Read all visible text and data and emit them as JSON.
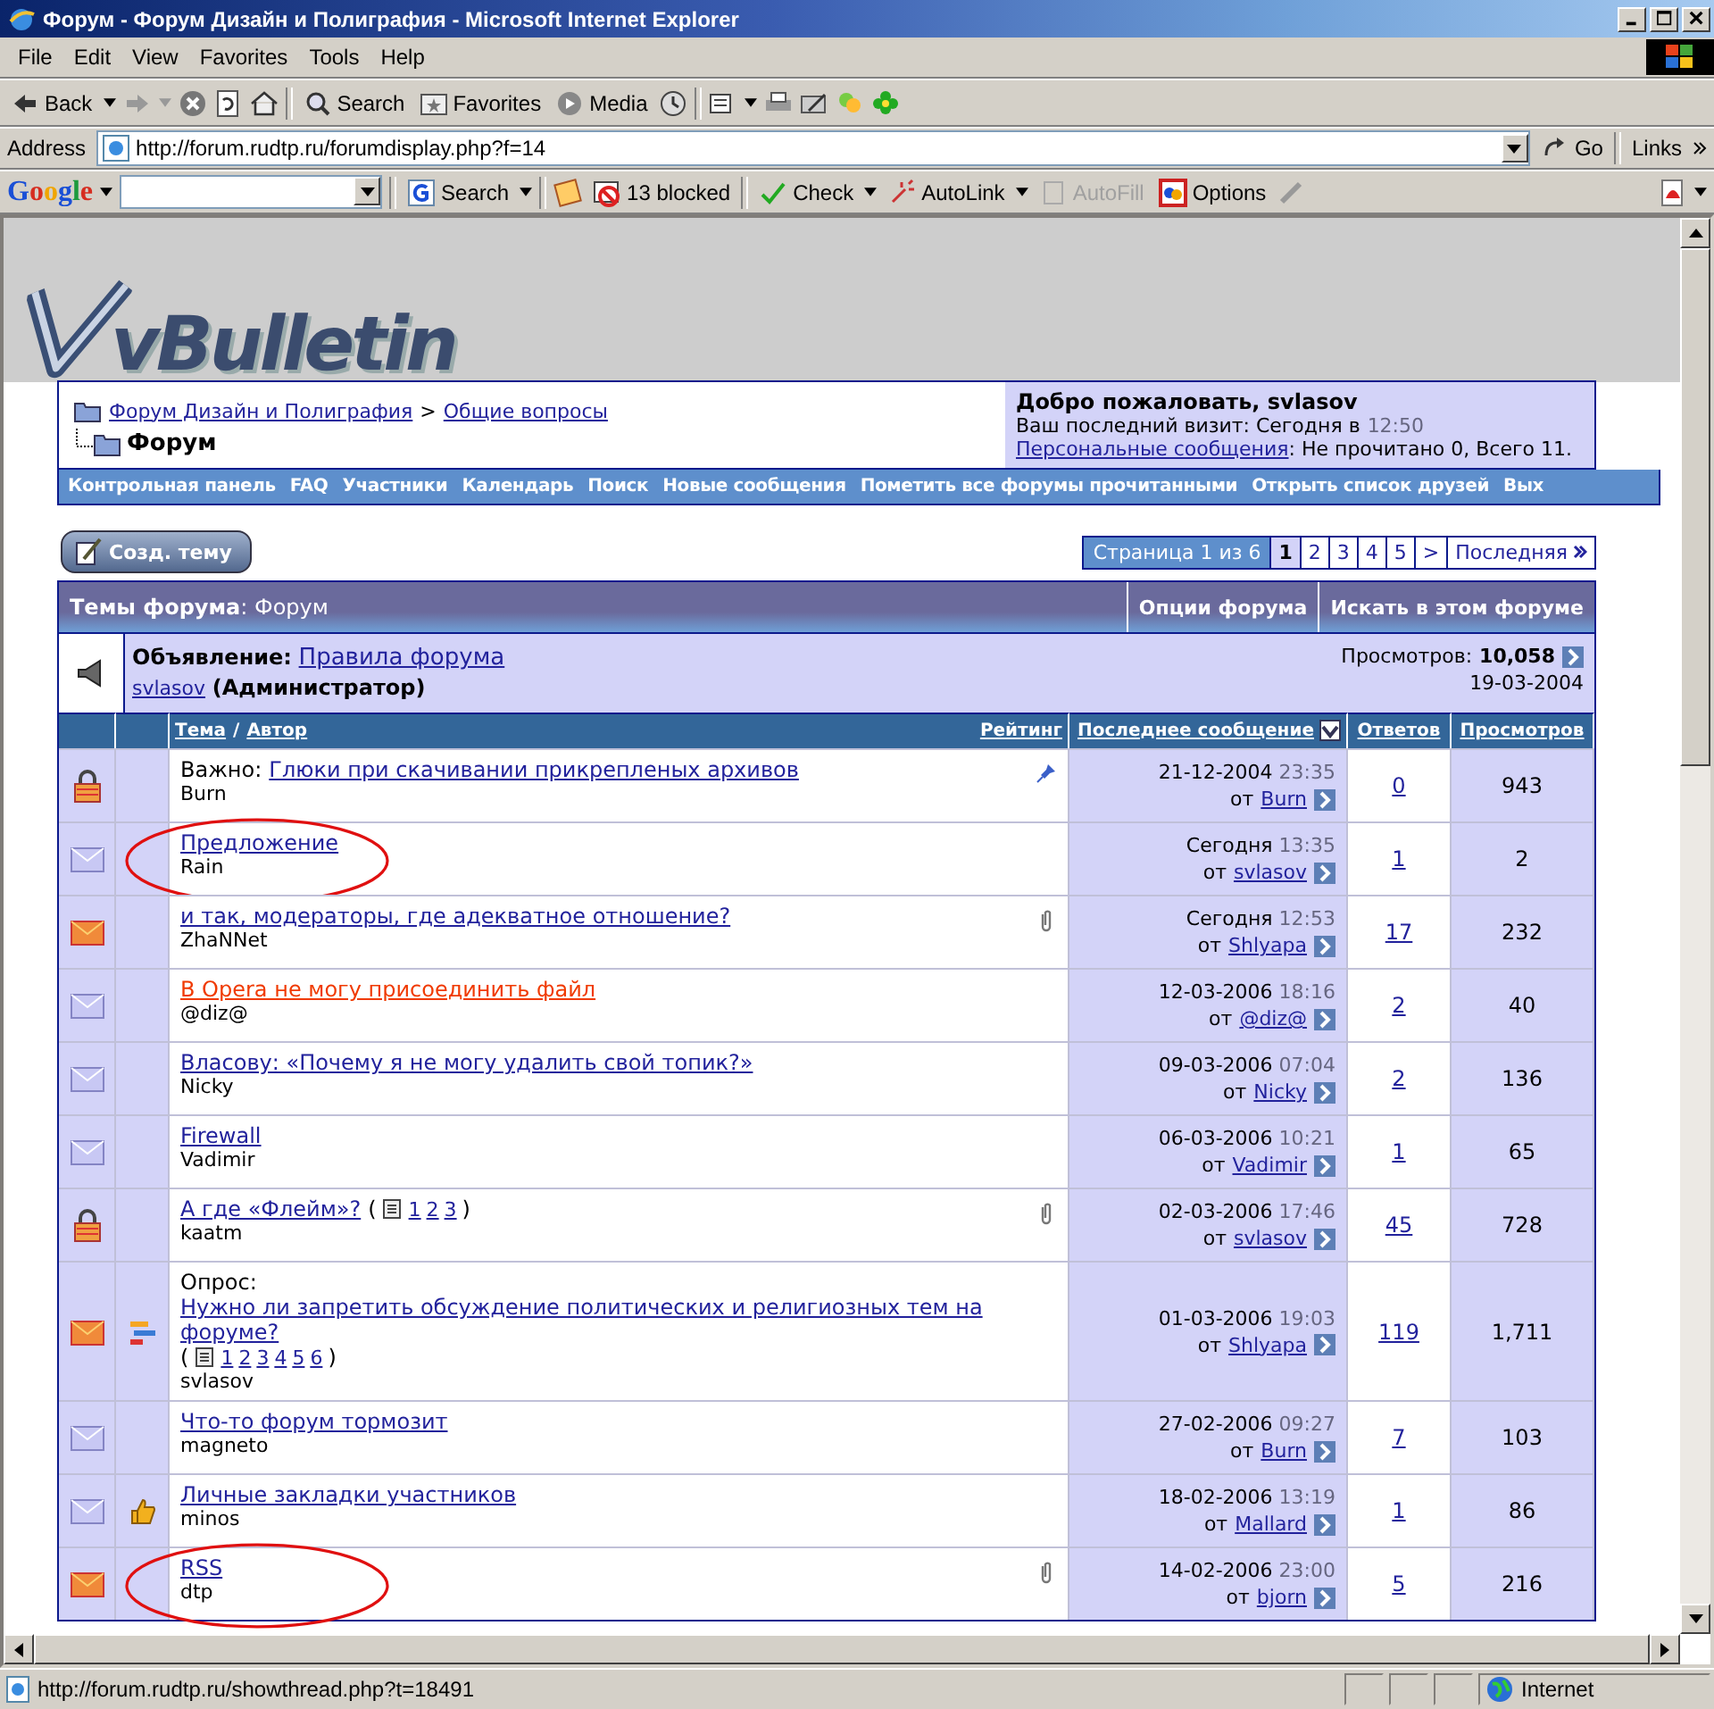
{
  "window": {
    "title": "Форум - Форум Дизайн и Полиграфия - Microsoft Internet Explorer"
  },
  "menu": [
    "File",
    "Edit",
    "View",
    "Favorites",
    "Tools",
    "Help"
  ],
  "toolbar": {
    "back": "Back",
    "search": "Search",
    "favorites": "Favorites",
    "media": "Media"
  },
  "address": {
    "label": "Address",
    "url": "http://forum.rudtp.ru/forumdisplay.php?f=14",
    "go": "Go",
    "links": "Links"
  },
  "google_bar": {
    "logo": "Google",
    "search": "Search",
    "blocked": "13 blocked",
    "check": "Check",
    "autolink": "AutoLink",
    "autofill": "AutoFill",
    "autofill_disabled": true,
    "options": "Options"
  },
  "logo": "vBulletin",
  "breadcrumb": {
    "links": [
      "Форум Дизайн и Полиграфия",
      "Общие вопросы"
    ],
    "separator": ">",
    "current": "Форум"
  },
  "welcome": {
    "title": "Добро пожаловать, svlasov",
    "last_visit": "Ваш последний визит: Сегодня в",
    "last_visit_time": "12:50",
    "pm_link": "Персональные сообщения",
    "pm_text": ": Не прочитано 0, Всего 11."
  },
  "navbar": [
    "Контрольная панель",
    "FAQ",
    "Участники",
    "Календарь",
    "Поиск",
    "Новые сообщения",
    "Пометить все форумы прочитанными",
    "Открыть список друзей",
    "Вых"
  ],
  "new_thread_button": "Созд. тему",
  "pagination": {
    "label": "Страница 1 из 6",
    "pages": [
      {
        "label": "1",
        "selected": true
      },
      {
        "label": "2",
        "selected": false
      },
      {
        "label": "3",
        "selected": false
      },
      {
        "label": "4",
        "selected": false
      },
      {
        "label": "5",
        "selected": false
      }
    ],
    "next": ">",
    "last": "Последняя"
  },
  "threads_header": {
    "title": "Темы форума",
    "forum": ": Форум",
    "buttons": [
      "Опции форума",
      "Искать в этом форуме"
    ]
  },
  "announcement": {
    "prefix": "Объявление:",
    "title": "Правила форума",
    "author": "svlasov",
    "role": "(Администратор)",
    "views_label": "Просмотров:",
    "views": "10,058",
    "date": "19-03-2004"
  },
  "columns": {
    "topic": "Тема",
    "slash": "/",
    "author": "Автор",
    "rating": "Рейтинг",
    "last_post": "Последнее сообщение",
    "replies": "Ответов",
    "views": "Просмотров"
  },
  "rows": [
    {
      "kind": "locked",
      "prefix": "Важно:",
      "title": "Глюки при скачивании прикрепленых архивов",
      "highlighted": false,
      "attachment": false,
      "sticky": true,
      "author": "Burn",
      "date": "21-12-2004",
      "time": "23:35",
      "by_label": "от",
      "last_by": "Burn",
      "replies": "0",
      "views": "943",
      "circled": false
    },
    {
      "kind": "new",
      "title": "Предложение",
      "highlighted": false,
      "attachment": false,
      "sticky": false,
      "author": "Rain",
      "date": "Сегодня",
      "time": "13:35",
      "by_label": "от",
      "last_by": "svlasov",
      "replies": "1",
      "views": "2",
      "circled": true
    },
    {
      "kind": "hot",
      "title": "и так, модераторы, где адекватное отношение?",
      "highlighted": false,
      "attachment": true,
      "sticky": false,
      "author": "ZhaNNet",
      "date": "Сегодня",
      "time": "12:53",
      "by_label": "от",
      "last_by": "Shlyapa",
      "replies": "17",
      "views": "232",
      "circled": false
    },
    {
      "kind": "new",
      "title": "В Opera не могу присоединить файл",
      "highlighted": true,
      "attachment": false,
      "sticky": false,
      "author": "@diz@",
      "date": "12-03-2006",
      "time": "18:16",
      "by_label": "от",
      "last_by": "@diz@",
      "replies": "2",
      "views": "40",
      "circled": false
    },
    {
      "kind": "new",
      "title": "Власову: «Почему я не могу удалить свой топик?»",
      "highlighted": false,
      "attachment": false,
      "sticky": false,
      "author": "Nicky",
      "date": "09-03-2006",
      "time": "07:04",
      "by_label": "от",
      "last_by": "Nicky",
      "replies": "2",
      "views": "136",
      "circled": false
    },
    {
      "kind": "new",
      "title": "Firewall",
      "highlighted": false,
      "attachment": false,
      "sticky": false,
      "author": "Vadimir",
      "date": "06-03-2006",
      "time": "10:21",
      "by_label": "от",
      "last_by": "Vadimir",
      "replies": "1",
      "views": "65",
      "circled": false
    },
    {
      "kind": "locked",
      "title": "А где «Флейм»?",
      "highlighted": false,
      "pages": {
        "open": "(",
        "links": [
          "1",
          "2",
          "3"
        ],
        "close": ")"
      },
      "attachment": true,
      "sticky": false,
      "author": "kaatm",
      "date": "02-03-2006",
      "time": "17:46",
      "by_label": "от",
      "last_by": "svlasov",
      "replies": "45",
      "views": "728",
      "circled": false
    },
    {
      "kind": "hot",
      "post_icon": {
        "kind": "poll"
      },
      "prefix": "Опрос:",
      "title": "Нужно ли запретить обсуждение политических и религиозных тем на форуме?",
      "highlighted": false,
      "pages": {
        "open": "(",
        "links": [
          "1",
          "2",
          "3",
          "4",
          "5",
          "6"
        ],
        "close": ")"
      },
      "attachment": false,
      "sticky": false,
      "author": "svlasov",
      "date": "01-03-2006",
      "time": "19:03",
      "by_label": "от",
      "last_by": "Shlyapa",
      "replies": "119",
      "views": "1,711",
      "circled": false
    },
    {
      "kind": "new",
      "title": "Что-то форум тормозит",
      "highlighted": false,
      "attachment": false,
      "sticky": false,
      "author": "magneto",
      "date": "27-02-2006",
      "time": "09:27",
      "by_label": "от",
      "last_by": "Burn",
      "replies": "7",
      "views": "103",
      "circled": false
    },
    {
      "kind": "new",
      "post_icon": {
        "kind": "thumb"
      },
      "title": "Личные закладки участников",
      "highlighted": false,
      "attachment": false,
      "sticky": false,
      "author": "minos",
      "date": "18-02-2006",
      "time": "13:19",
      "by_label": "от",
      "last_by": "Mallard",
      "replies": "1",
      "views": "86",
      "circled": false
    },
    {
      "kind": "hot",
      "title": "RSS",
      "highlighted": false,
      "attachment": true,
      "sticky": false,
      "author": "dtp",
      "date": "14-02-2006",
      "time": "23:00",
      "by_label": "от",
      "last_by": "bjorn",
      "replies": "5",
      "views": "216",
      "circled": true
    }
  ],
  "status_bar": {
    "url": "http://forum.rudtp.ru/showthread.php?t=18491",
    "zone": "Internet"
  }
}
